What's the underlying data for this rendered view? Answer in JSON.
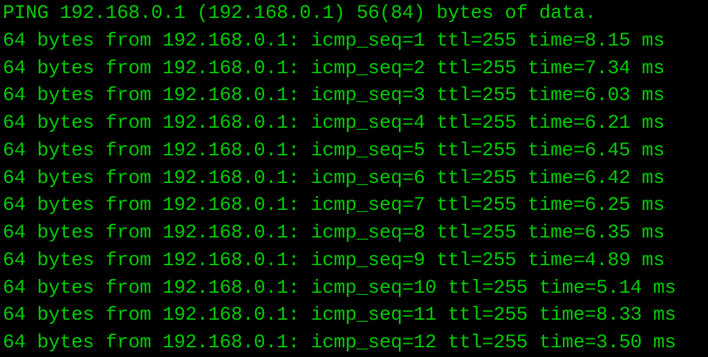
{
  "header": "PING 192.168.0.1 (192.168.0.1) 56(84) bytes of data.",
  "lines": [
    "64 bytes from 192.168.0.1: icmp_seq=1 ttl=255 time=8.15 ms",
    "64 bytes from 192.168.0.1: icmp_seq=2 ttl=255 time=7.34 ms",
    "64 bytes from 192.168.0.1: icmp_seq=3 ttl=255 time=6.03 ms",
    "64 bytes from 192.168.0.1: icmp_seq=4 ttl=255 time=6.21 ms",
    "64 bytes from 192.168.0.1: icmp_seq=5 ttl=255 time=6.45 ms",
    "64 bytes from 192.168.0.1: icmp_seq=6 ttl=255 time=6.42 ms",
    "64 bytes from 192.168.0.1: icmp_seq=7 ttl=255 time=6.25 ms",
    "64 bytes from 192.168.0.1: icmp_seq=8 ttl=255 time=6.35 ms",
    "64 bytes from 192.168.0.1: icmp_seq=9 ttl=255 time=4.89 ms",
    "64 bytes from 192.168.0.1: icmp_seq=10 ttl=255 time=5.14 ms",
    "64 bytes from 192.168.0.1: icmp_seq=11 ttl=255 time=8.33 ms",
    "64 bytes from 192.168.0.1: icmp_seq=12 ttl=255 time=3.50 ms"
  ]
}
